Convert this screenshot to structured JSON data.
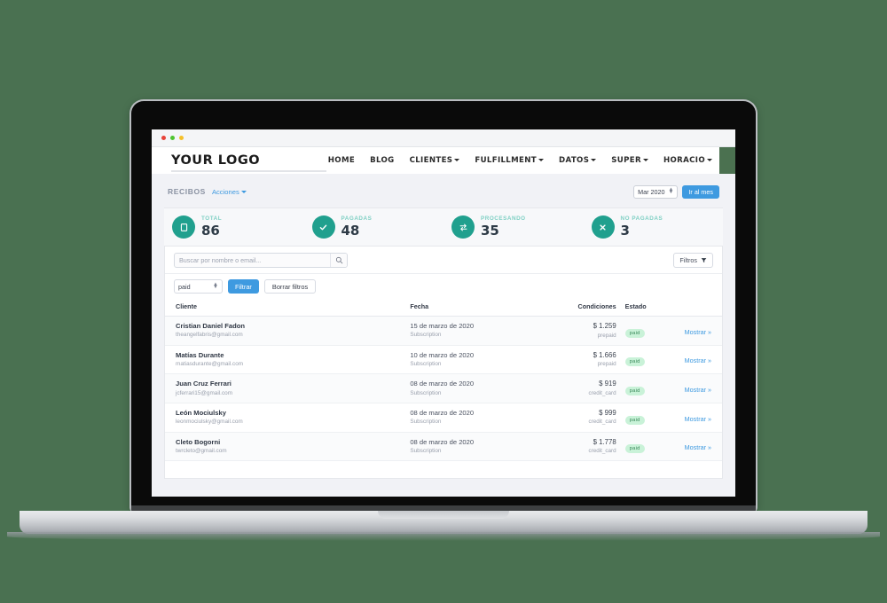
{
  "browser": {
    "dots": [
      "red",
      "green",
      "yellow"
    ]
  },
  "nav": {
    "brand": "YOUR LOGO",
    "links": [
      {
        "label": "HOME",
        "caret": false
      },
      {
        "label": "BLOG",
        "caret": false
      },
      {
        "label": "CLIENTES",
        "caret": true
      },
      {
        "label": "FULFILLMENT",
        "caret": true
      },
      {
        "label": "DATOS",
        "caret": true
      },
      {
        "label": "SUPER",
        "caret": true
      },
      {
        "label": "HORACIO",
        "caret": true
      }
    ],
    "avatar_color": "#4b7150"
  },
  "breadcrumb": {
    "title": "RECIBOS",
    "actions_label": "Acciones",
    "month_value": "Mar 2020",
    "goto_month_label": "Ir al mes"
  },
  "stats": [
    {
      "label": "TOTAL",
      "value": "86",
      "icon": "document-icon"
    },
    {
      "label": "PAGADAS",
      "value": "48",
      "icon": "check-icon"
    },
    {
      "label": "PROCESANDO",
      "value": "35",
      "icon": "transfer-icon"
    },
    {
      "label": "NO PAGADAS",
      "value": "3",
      "icon": "close-icon"
    }
  ],
  "search": {
    "placeholder": "Buscar por nombre o email...",
    "value": "",
    "filtros_label": "Filtros"
  },
  "filters": {
    "status_value": "paid",
    "apply_label": "Filtrar",
    "clear_label": "Borrar filtros"
  },
  "table": {
    "columns": [
      "Cliente",
      "Fecha",
      "Condiciones",
      "Estado",
      ""
    ],
    "rows": [
      {
        "client_name": "Cristian Daniel Fadon",
        "client_email": "theangelfabris@gmail.com",
        "date": "15 de marzo de 2020",
        "date_sub": "Subscription",
        "amount": "$ 1.259",
        "amount_sub": "prepaid",
        "status": "paid",
        "action": "Mostrar »"
      },
      {
        "client_name": "Matías Durante",
        "client_email": "matiasdurante@gmail.com",
        "date": "10 de marzo de 2020",
        "date_sub": "Subscription",
        "amount": "$ 1.666",
        "amount_sub": "prepaid",
        "status": "paid",
        "action": "Mostrar »"
      },
      {
        "client_name": "Juan Cruz Ferrari",
        "client_email": "jcferrari15@gmail.com",
        "date": "08 de marzo de 2020",
        "date_sub": "Subscription",
        "amount": "$ 919",
        "amount_sub": "credit_card",
        "status": "paid",
        "action": "Mostrar »"
      },
      {
        "client_name": "León Mociulsky",
        "client_email": "leonmociulsky@gmail.com",
        "date": "08 de marzo de 2020",
        "date_sub": "Subscription",
        "amount": "$ 999",
        "amount_sub": "credit_card",
        "status": "paid",
        "action": "Mostrar »"
      },
      {
        "client_name": "Cleto Bogorni",
        "client_email": "twrcleto@gmail.com",
        "date": "08 de marzo de 2020",
        "date_sub": "Subscription",
        "amount": "$ 1.778",
        "amount_sub": "credit_card",
        "status": "paid",
        "action": "Mostrar »"
      }
    ]
  },
  "colors": {
    "background": "#4a7151",
    "teal": "#20a08e",
    "blue": "#3e9ae0",
    "badge_bg": "#c9f2d8",
    "badge_text": "#3c8a5c"
  }
}
